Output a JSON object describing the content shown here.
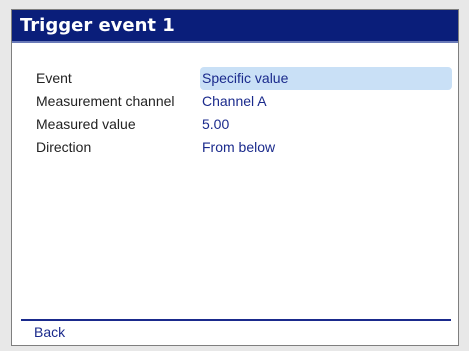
{
  "window": {
    "title": "Trigger event 1"
  },
  "params": [
    {
      "label": "Event",
      "value": "Specific value",
      "selected": true
    },
    {
      "label": "Measurement channel",
      "value": "Channel A",
      "selected": false
    },
    {
      "label": "Measured value",
      "value": "5.00",
      "selected": false
    },
    {
      "label": "Direction",
      "value": "From below",
      "selected": false
    }
  ],
  "footer": {
    "back_label": "Back"
  },
  "colors": {
    "title_bar": "#0a1e7a",
    "value_text": "#1a2a8c",
    "selection_highlight": "#c9e0f6",
    "label_text": "#222222"
  }
}
